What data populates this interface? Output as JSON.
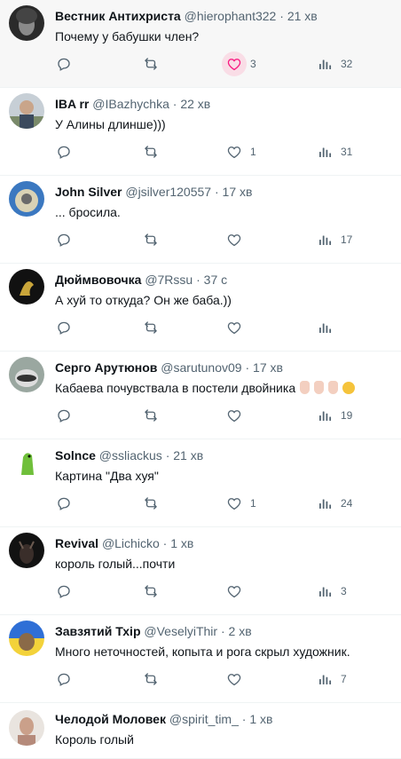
{
  "colors": {
    "icon": "#536471",
    "like_active_bg": "#f9dde6",
    "like_active": "#f91880"
  },
  "tweets": [
    {
      "name": "Вестник Антихриста",
      "handle": "@hierophant322",
      "time": "21 хв",
      "text": "Почему у бабушки член?",
      "replies": "",
      "retweets": "",
      "likes": "3",
      "views": "32",
      "avatar": "dark-face"
    },
    {
      "name": "IBA rr",
      "handle": "@IBazhychka",
      "time": "22 хв",
      "text": "У Алины длинше)))",
      "replies": "",
      "retweets": "",
      "likes": "1",
      "views": "31",
      "avatar": "photo-person"
    },
    {
      "name": "John Silver",
      "handle": "@jsilver120557",
      "time": "17 хв",
      "text": "... бросила.",
      "replies": "",
      "retweets": "",
      "likes": "",
      "views": "17",
      "avatar": "blue-bird"
    },
    {
      "name": "Дюймвовочка",
      "handle": "@7Rssu",
      "time": "37 с",
      "text": "А хуй то откуда? Он же баба.))",
      "replies": "",
      "retweets": "",
      "likes": "",
      "views": "",
      "avatar": "dark-gold"
    },
    {
      "name": "Серго Арутюнов",
      "handle": "@sarutunov09",
      "time": "17 хв",
      "text": "Кабаева почувствала в постели двойника",
      "emoji": [
        "hand-emoji",
        "hand-emoji",
        "hand-emoji",
        "thinking-emoji"
      ],
      "replies": "",
      "retweets": "",
      "likes": "",
      "views": "19",
      "avatar": "raccoon"
    },
    {
      "name": "Solnce",
      "handle": "@ssliackus",
      "time": "21 хв",
      "text": "Картина \"Два хуя\"",
      "replies": "",
      "retweets": "",
      "likes": "1",
      "views": "24",
      "avatar": "green-dino"
    },
    {
      "name": "Revival",
      "handle": "@Lichicko",
      "time": "1 хв",
      "text": "король голый...почти",
      "replies": "",
      "retweets": "",
      "likes": "",
      "views": "3",
      "avatar": "dark-goat"
    },
    {
      "name": "Завзятий Тхір",
      "handle": "@VeselyiThir",
      "time": "2 хв",
      "text": "Много неточностей, копыта и рога скрыл художник.",
      "replies": "",
      "retweets": "",
      "likes": "",
      "views": "7",
      "avatar": "flag-ferret"
    },
    {
      "name": "Челодой Моловек",
      "handle": "@spirit_tim_",
      "time": "1 хв",
      "text": "Король голый",
      "replies": "",
      "retweets": "",
      "likes": "",
      "views": "",
      "avatar": "photo-man"
    }
  ]
}
